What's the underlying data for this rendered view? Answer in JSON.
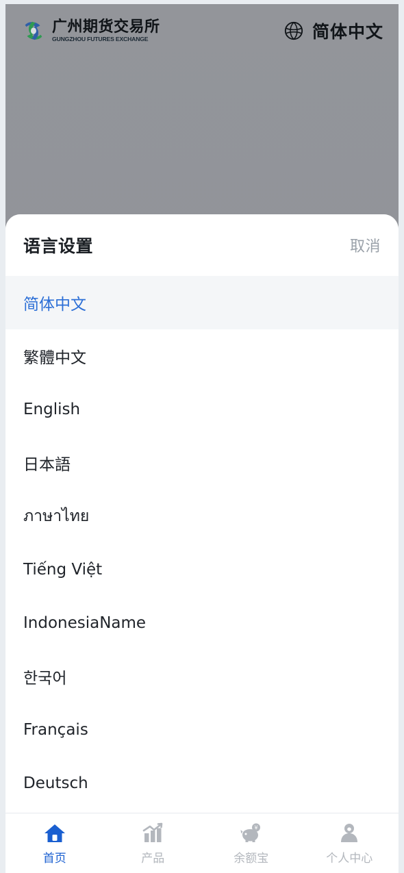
{
  "colors": {
    "accent": "#1a5fd0",
    "selected_text": "#2c6fd6",
    "selected_bg": "#f4f6f8",
    "muted": "#b3b7bd",
    "cancel": "#9aa1a9",
    "backdrop": "#919499",
    "sheet_bg": "#ffffff",
    "logo_blue": "#2e5fa8",
    "logo_green": "#2f9a52",
    "piggy": "#6b6f75"
  },
  "topbar": {
    "logo": {
      "icon": "exchange-swirl-logo",
      "name_cn": "广州期货交易所",
      "name_en": "GUNGZHOU FUTURES EXCHANGE"
    },
    "language_switch": {
      "icon": "globe-icon",
      "label": "简体中文"
    }
  },
  "sheet": {
    "title": "语言设置",
    "cancel_label": "取消",
    "languages": [
      {
        "label": "简体中文",
        "selected": true
      },
      {
        "label": "繁體中文",
        "selected": false
      },
      {
        "label": "English",
        "selected": false
      },
      {
        "label": "日本語",
        "selected": false
      },
      {
        "label": "ภาษาไทย",
        "selected": false
      },
      {
        "label": "Tiếng Việt",
        "selected": false
      },
      {
        "label": "IndonesiaName",
        "selected": false
      },
      {
        "label": "한국어",
        "selected": false
      },
      {
        "label": "Français",
        "selected": false
      },
      {
        "label": "Deutsch",
        "selected": false
      }
    ]
  },
  "tabbar": {
    "tabs": [
      {
        "label": "首页",
        "icon": "home-icon",
        "active": true
      },
      {
        "label": "产品",
        "icon": "bar-chart-trend-icon",
        "active": false
      },
      {
        "label": "余额宝",
        "icon": "piggy-bank-icon",
        "active": false
      },
      {
        "label": "个人中心",
        "icon": "person-icon",
        "active": false
      }
    ]
  }
}
